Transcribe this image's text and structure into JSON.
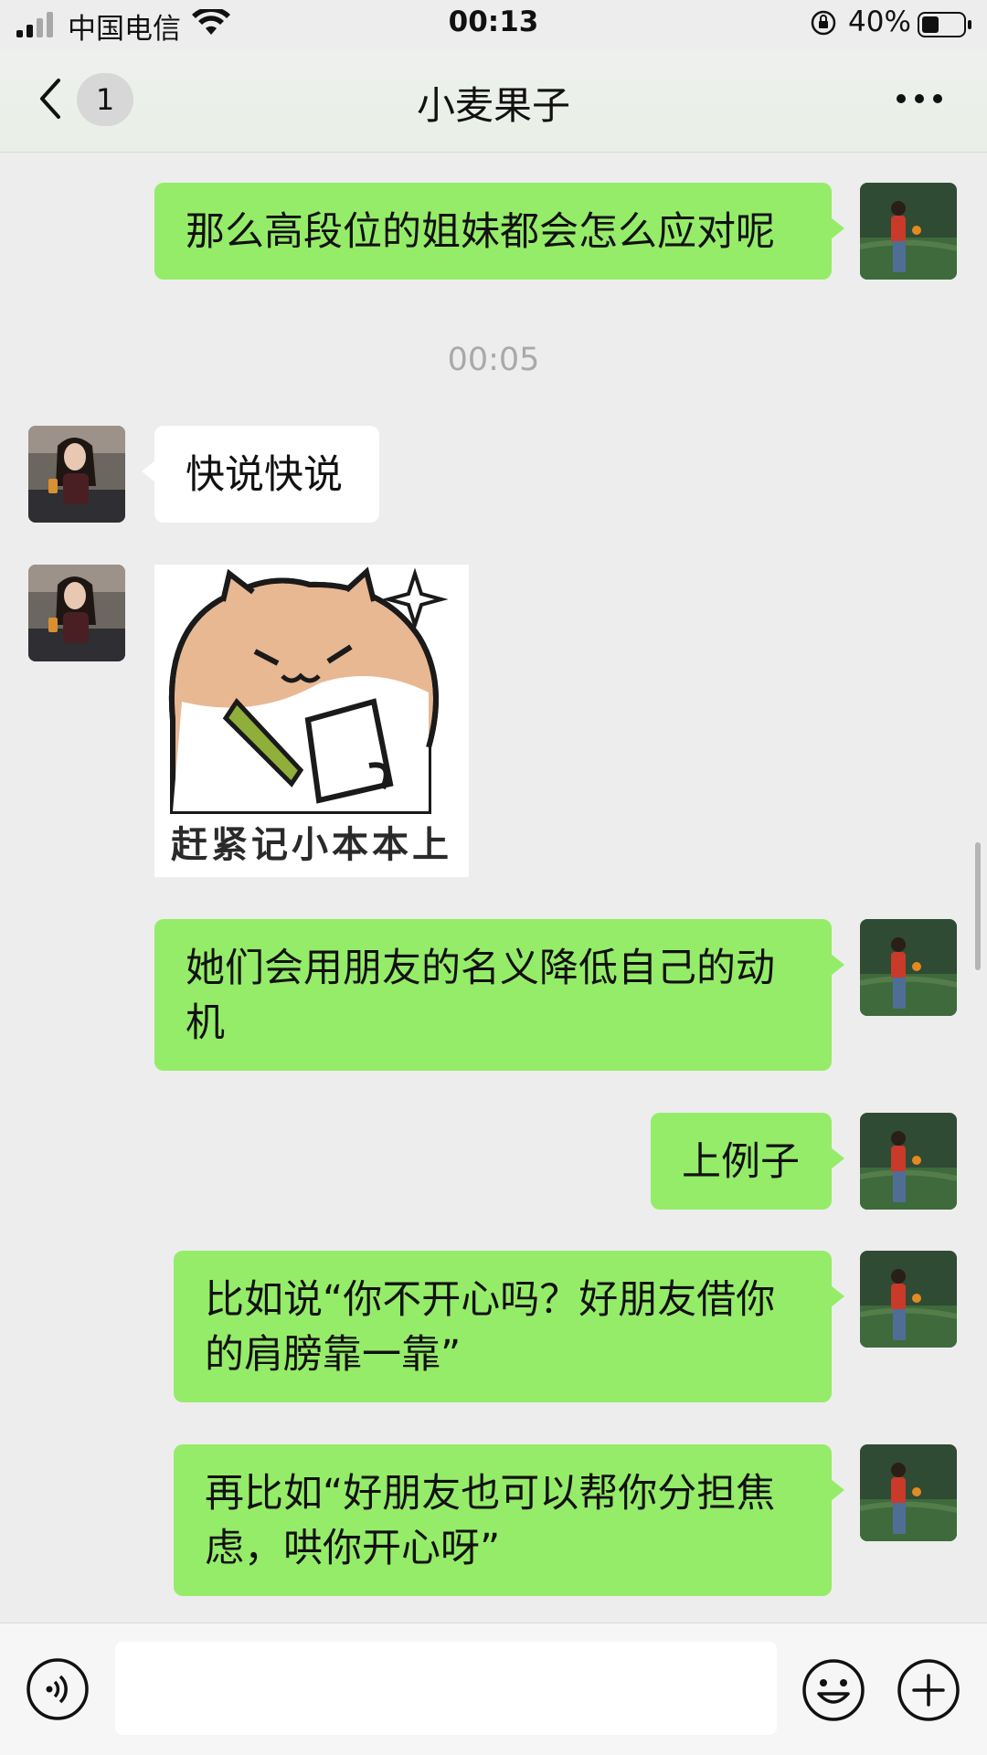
{
  "status_bar": {
    "carrier": "中国电信",
    "time": "00:13",
    "battery": "40%"
  },
  "header": {
    "unread_badge": "1",
    "title": "小麦果子"
  },
  "messages": [
    {
      "side": "right",
      "type": "text",
      "text": "那么高段位的姐妹都会怎么应对呢"
    },
    {
      "type": "timestamp",
      "text": "00:05"
    },
    {
      "side": "left",
      "type": "text",
      "text": "快说快说"
    },
    {
      "side": "left",
      "type": "sticker",
      "caption": "赶紧记小本本上"
    },
    {
      "side": "right",
      "type": "text",
      "text": "她们会用朋友的名义降低自己的动机"
    },
    {
      "side": "right",
      "type": "text",
      "text": "上例子"
    },
    {
      "side": "right",
      "type": "text",
      "text": "比如说“你不开心吗？好朋友借你的肩膀靠一靠”"
    },
    {
      "side": "right",
      "type": "text",
      "text": "再比如“好朋友也可以帮你分担焦虑，哄你开心呀”"
    }
  ],
  "input_bar": {
    "value": "",
    "icons": [
      "voice-icon",
      "emoji-icon",
      "plus-icon"
    ]
  },
  "colors": {
    "own_bubble": "#95EC69",
    "other_bubble": "#FFFFFF",
    "background": "#EDEDED"
  }
}
